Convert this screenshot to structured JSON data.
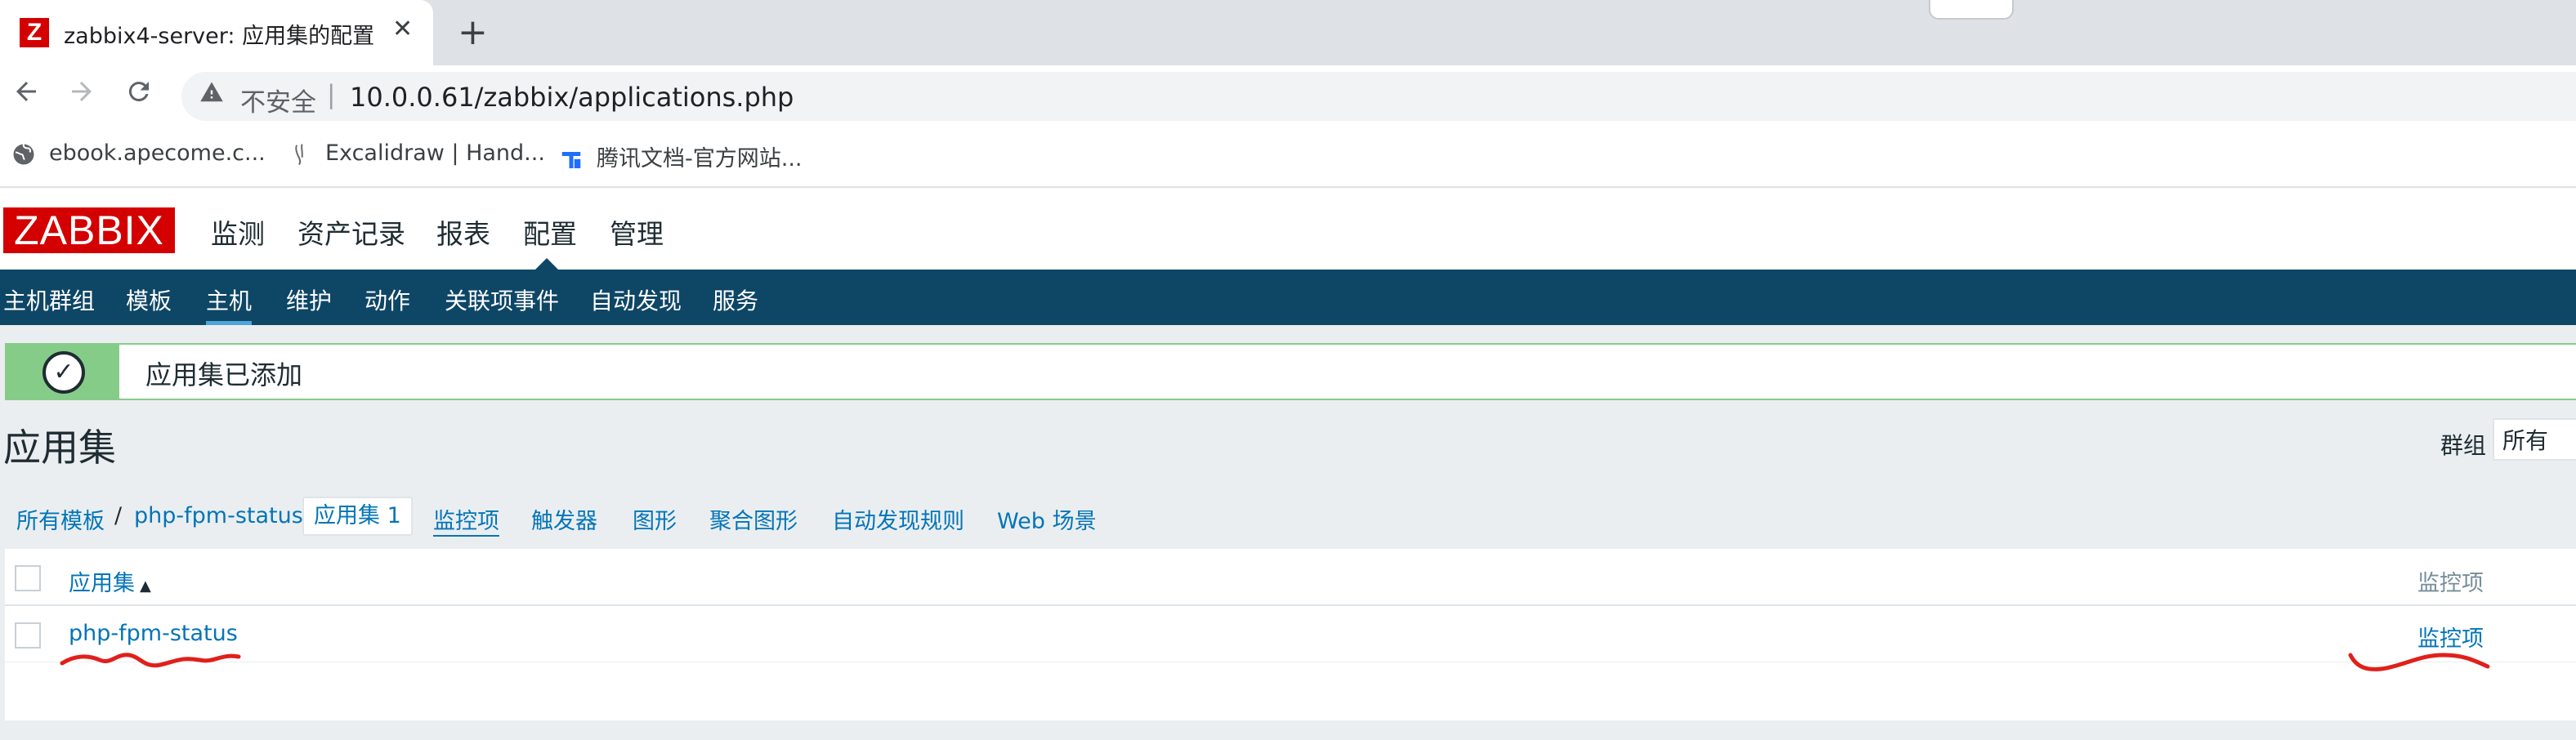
{
  "browser": {
    "tab_title": "zabbix4-server: 应用集的配置",
    "favicon_letter": "Z",
    "close_glyph": "✕",
    "new_tab_glyph": "+",
    "not_secure_label": "不安全",
    "url_separator": "|",
    "url": "10.0.0.61/zabbix/applications.php",
    "bookmarks": [
      {
        "label": "ebook.apecome.c...",
        "icon": "globe-icon"
      },
      {
        "label": "Excalidraw | Hand...",
        "icon": "excalidraw-icon"
      },
      {
        "label": "腾讯文档-官方网站...",
        "icon": "tencent-docs-icon"
      }
    ]
  },
  "zabbix": {
    "logo": "ZABBIX",
    "main_nav": [
      "监测",
      "资产记录",
      "报表",
      "配置",
      "管理"
    ],
    "main_nav_active": "配置",
    "sub_nav": [
      "主机群组",
      "模板",
      "主机",
      "维护",
      "动作",
      "关联项事件",
      "自动发现",
      "服务"
    ],
    "sub_nav_active": "主机"
  },
  "message": {
    "text": "应用集已添加",
    "icon": "check-circle-icon",
    "check_glyph": "✓"
  },
  "page": {
    "title": "应用集",
    "filter_label": "群组",
    "filter_value": "所有"
  },
  "breadcrumbs": {
    "all_templates": "所有模板",
    "separator": "/",
    "template": "php-fpm-status",
    "applications_tab": "应用集",
    "applications_count": "1",
    "items": "监控项",
    "triggers": "触发器",
    "graphs": "图形",
    "screens": "聚合图形",
    "discovery_rules": "自动发现规则",
    "web_scenarios": "Web 场景"
  },
  "table": {
    "col_application": "应用集",
    "sort_glyph": "▲",
    "col_items": "监控项",
    "rows": [
      {
        "application": "php-fpm-status",
        "items": "监控项"
      }
    ]
  },
  "colors": {
    "zabbix_red": "#d40000",
    "subnav_bg": "#0e4666",
    "link": "#0275b8",
    "success_green": "#86cc89",
    "annotation_red": "#e0201b"
  }
}
